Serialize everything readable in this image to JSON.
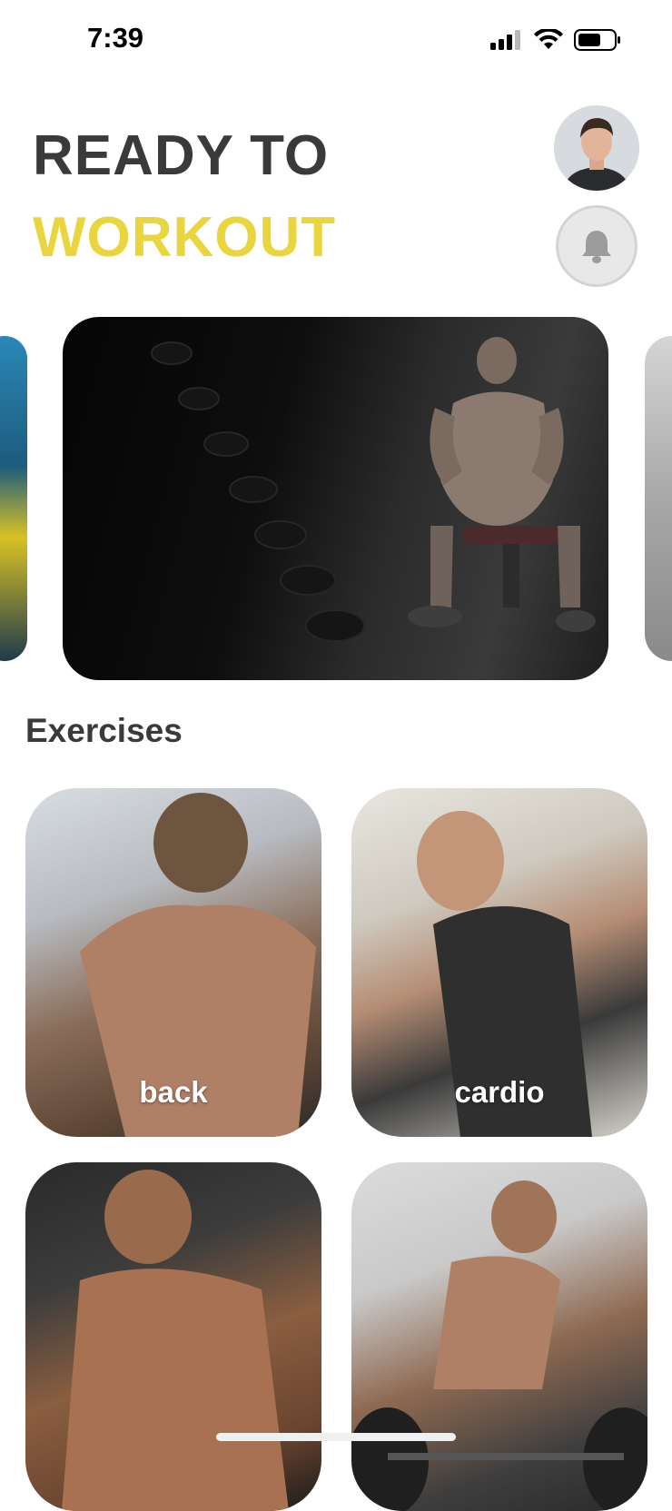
{
  "status_bar": {
    "time": "7:39"
  },
  "header": {
    "title_line_1": "READY TO",
    "title_line_2": "WORKOUT",
    "title_color_1": "#3a3a3a",
    "title_color_2": "#e9d63e"
  },
  "hero": {
    "icon": "gym-photo"
  },
  "exercises": {
    "section_title": "Exercises",
    "items": [
      {
        "label": "back"
      },
      {
        "label": "cardio"
      },
      {
        "label": ""
      },
      {
        "label": ""
      }
    ]
  }
}
